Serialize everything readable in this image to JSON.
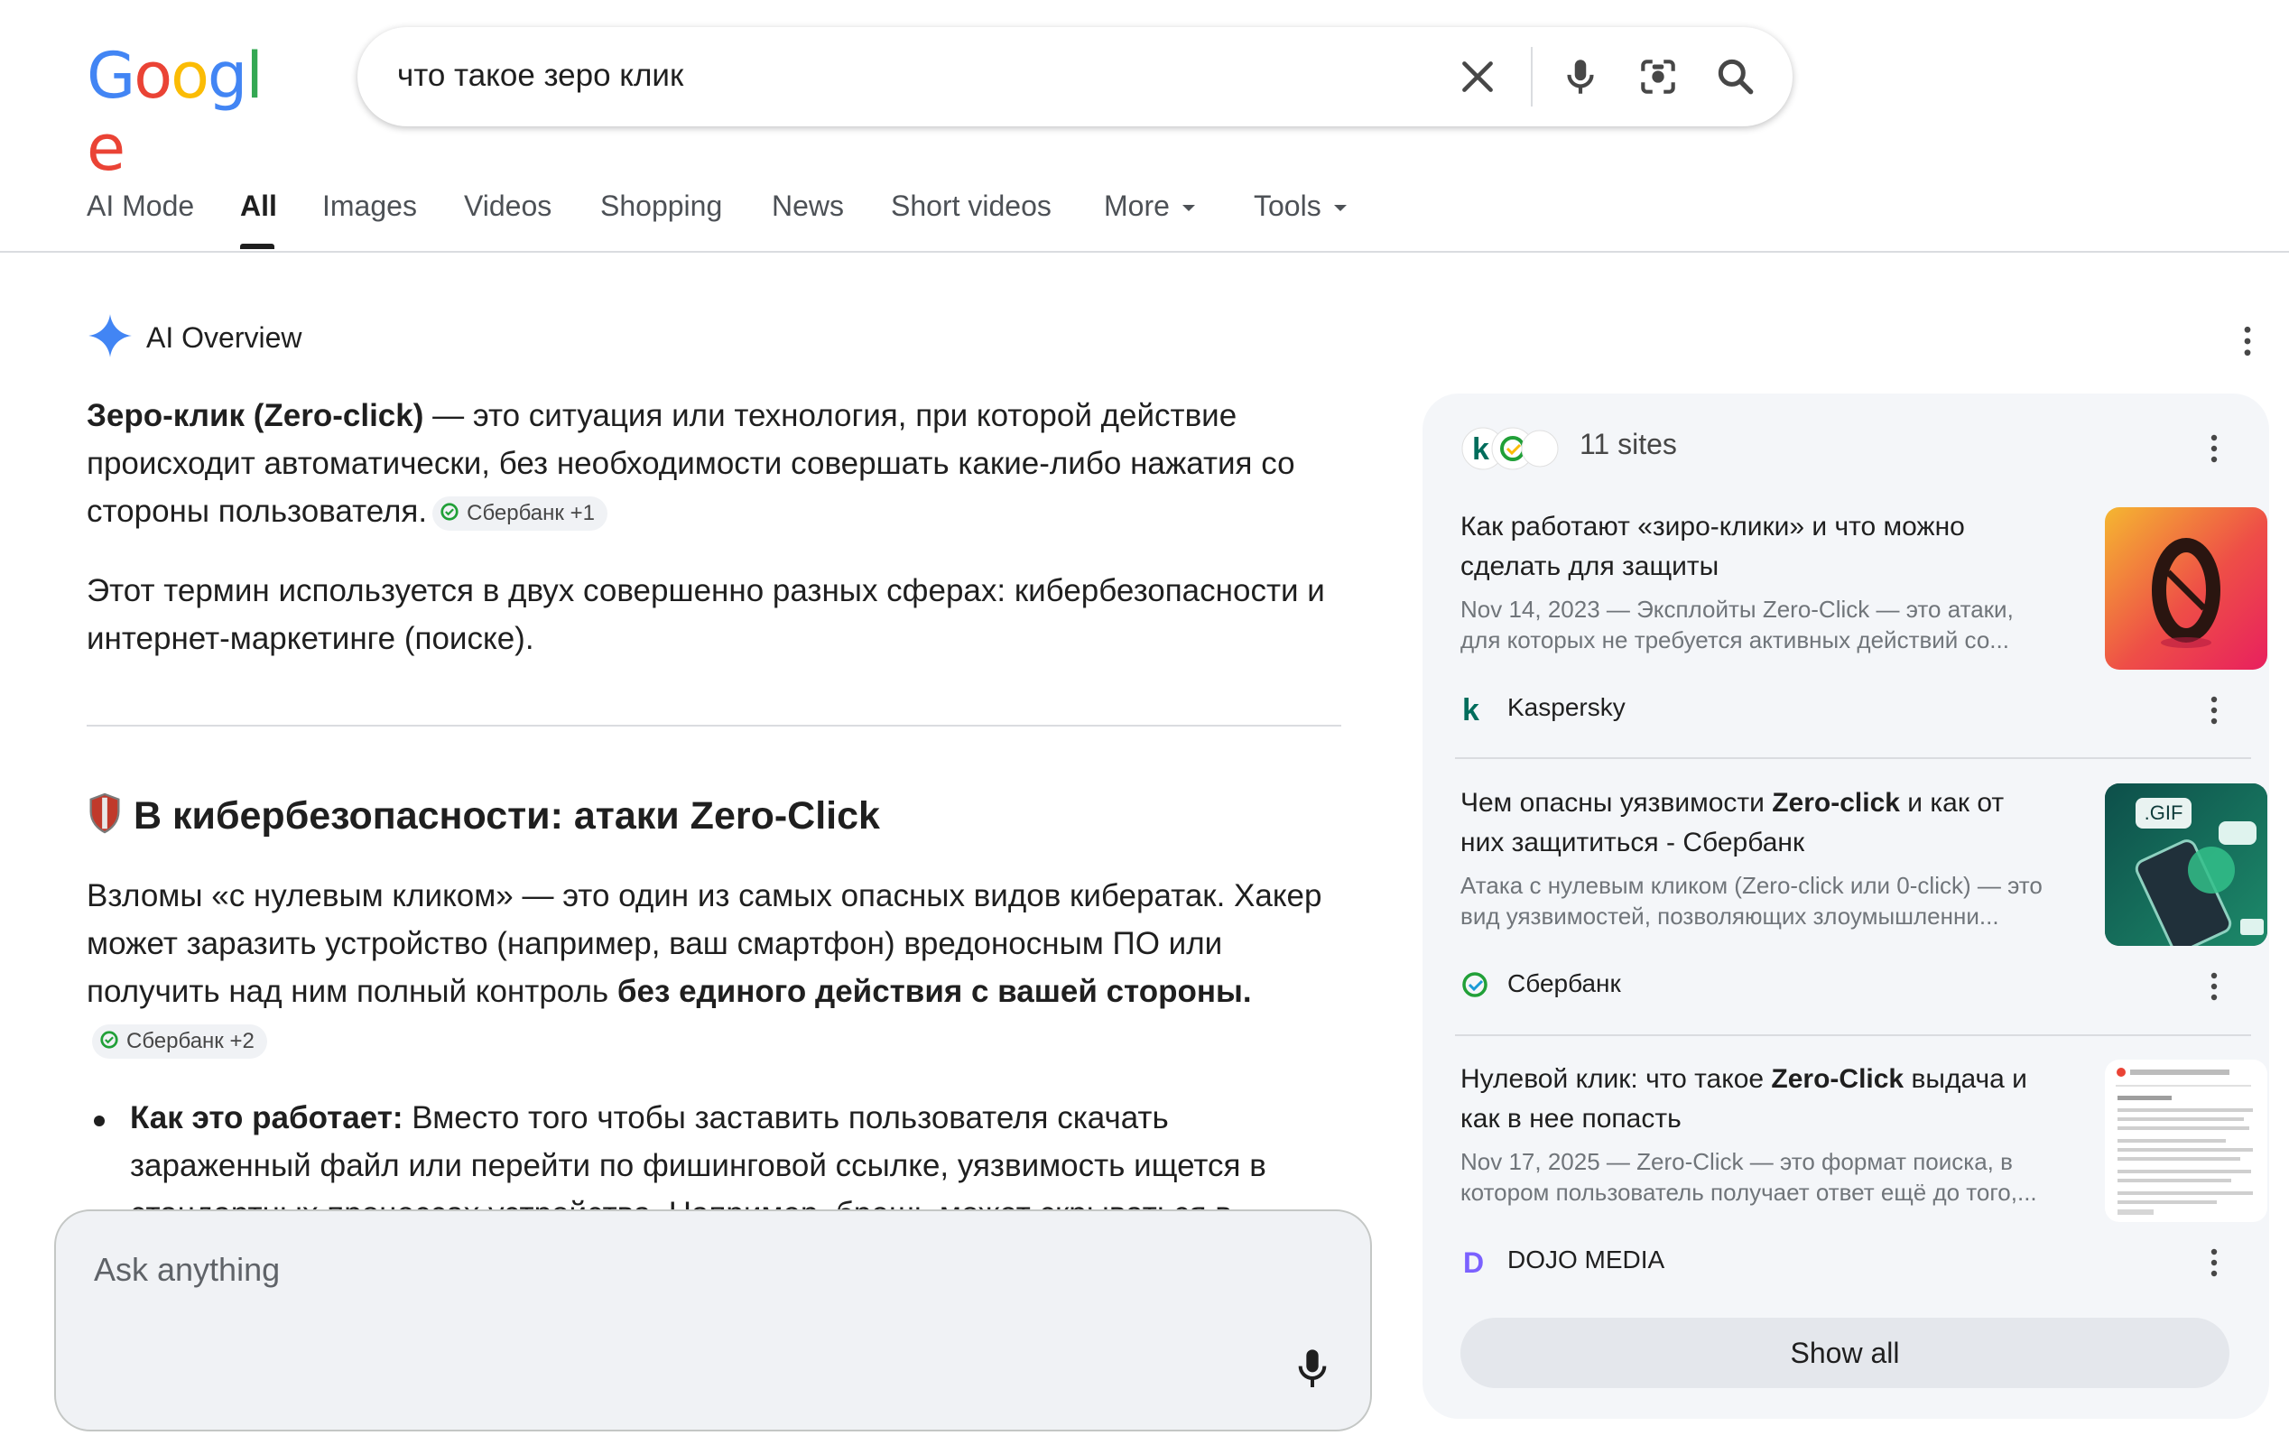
{
  "logo": "Google",
  "search": {
    "query": "что такое зеро клик"
  },
  "tabs": [
    {
      "label": "AI Mode"
    },
    {
      "label": "All"
    },
    {
      "label": "Images"
    },
    {
      "label": "Videos"
    },
    {
      "label": "Shopping"
    },
    {
      "label": "News"
    },
    {
      "label": "Short videos"
    },
    {
      "label": "More"
    },
    {
      "label": "Tools"
    }
  ],
  "overview": {
    "title": "AI Overview",
    "p1_bold": "Зеро-клик (Zero-click)",
    "p1_rest": " — это ситуация или технология, при которой действие происходит автоматически, без необходимости совершать какие-либо нажатия со стороны пользователя.",
    "p1_chip": "Сбербанк +1",
    "p2": "Этот термин используется в двух совершенно разных сферах: кибербезопасности и интернет-маркетинге (поиске).",
    "h2": "В кибербезопасности: атаки Zero-Click",
    "p3_start": "Взломы «с нулевым кликом» — это один из самых опасных видов кибератак. Хакер может заразить устройство (например, ваш смартфон) вредоносным ПО или получить над ним полный контроль ",
    "p3_bold": "без единого действия с вашей стороны",
    "p3_end": ".",
    "p3_chip": "Сбербанк +2",
    "bullet_bold": "Как это работает:",
    "bullet_rest": " Вместо того чтобы заставить пользователя скачать зараженный файл или перейти по фишинговой ссылке, уязвимость ищется в стандартных процессах устройства. Например, брешь может скрываться в"
  },
  "ask": {
    "placeholder": "Ask anything"
  },
  "panel": {
    "sites_label": "11 sites",
    "sources": [
      {
        "title": "Как работают «зиро-клики» и что можно сделать для защиты",
        "snippet": "Nov 14, 2023 — Эксплойты Zero-Click — это атаки, для которых не требуется активных действий со...",
        "name": "Kaspersky"
      },
      {
        "title_pre": "Чем опасны уязвимости ",
        "title_bold": "Zero-click",
        "title_post": " и как от них защититься - Сбербанк",
        "snippet": "Атака с нулевым кликом (Zero-click или 0-click) — это вид уязвимостей, позволяющих злоумышленни...",
        "thumb_label": ".GIF",
        "name": "Сбербанк"
      },
      {
        "title_pre": "Нулевой клик: что такое ",
        "title_bold": "Zero-Click",
        "title_post": " выдача и как в нее попасть",
        "snippet": "Nov 17, 2025 — Zero-Click — это формат поиска, в котором пользователь получает ответ ещё до того,...",
        "name": "DOJO MEDIA"
      }
    ],
    "show_all": "Show all"
  },
  "colors": {
    "google_blue": "#4285F4",
    "google_red": "#EA4335",
    "google_yellow": "#FBBC05",
    "google_green": "#34A853",
    "sber_green": "#21A038",
    "kaspersky_green": "#006D5C"
  }
}
